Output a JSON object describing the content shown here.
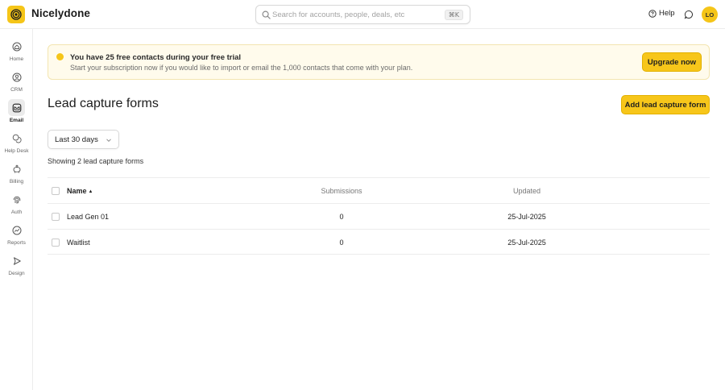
{
  "app": {
    "brand": "Nicelydone"
  },
  "header": {
    "search_placeholder": "Search for accounts, people, deals, etc",
    "search_shortcut": "⌘K",
    "help_label": "Help",
    "avatar_initials": "LO"
  },
  "sidebar": {
    "items": [
      {
        "label": "Home",
        "icon": "home-icon",
        "active": false
      },
      {
        "label": "CRM",
        "icon": "user-circle-icon",
        "active": false
      },
      {
        "label": "Email",
        "icon": "email-icon",
        "active": true
      },
      {
        "label": "Help Desk",
        "icon": "chat-bubbles-icon",
        "active": false
      },
      {
        "label": "Billing",
        "icon": "piggy-bank-icon",
        "active": false
      },
      {
        "label": "Auth",
        "icon": "fingerprint-icon",
        "active": false
      },
      {
        "label": "Reports",
        "icon": "chart-icon",
        "active": false
      },
      {
        "label": "Design",
        "icon": "cursor-icon",
        "active": false
      }
    ]
  },
  "banner": {
    "title": "You have 25 free contacts during your free trial",
    "description": "Start your subscription now if you would like to import or email the 1,000 contacts that come with your plan.",
    "button": "Upgrade now"
  },
  "main": {
    "title": "Lead capture forms",
    "add_button": "Add lead capture form",
    "date_filter": "Last 30 days",
    "showing_text": "Showing 2 lead capture forms",
    "table": {
      "columns": [
        "Name",
        "Submissions",
        "Updated"
      ],
      "rows": [
        {
          "name": "Lead Gen 01",
          "submissions": "0",
          "updated": "25-Jul-2025"
        },
        {
          "name": "Waitlist",
          "submissions": "0",
          "updated": "25-Jul-2025"
        }
      ]
    }
  },
  "colors": {
    "accent": "#f7c61a",
    "banner_bg": "#fffbec",
    "border": "#ececec"
  }
}
